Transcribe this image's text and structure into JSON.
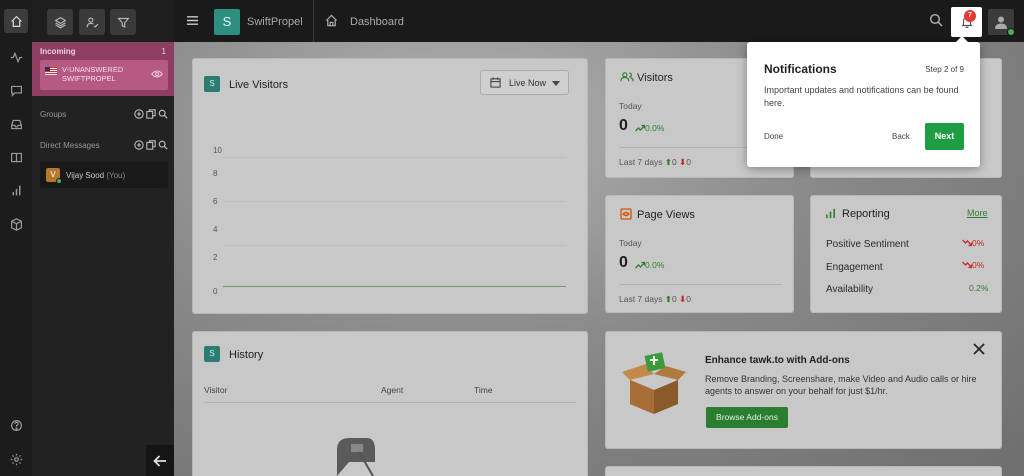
{
  "header": {
    "brand_initial": "S",
    "brand": "SwiftPropel",
    "breadcrumb": "Dashboard",
    "notification_count": "7"
  },
  "sidebar": {
    "incoming": {
      "title": "Incoming",
      "count": "1",
      "item_label": "V-UNANSWERED SWIFTPROPEL"
    },
    "groups_label": "Groups",
    "direct_messages_label": "Direct Messages",
    "dm_user": {
      "initial": "V",
      "name": "Vijay Sood",
      "suffix": "(You)"
    }
  },
  "live_visitors": {
    "badge": "S",
    "title": "Live Visitors",
    "dropdown_value": "Live Now",
    "y_ticks": [
      "10",
      "8",
      "6",
      "4",
      "2",
      "0"
    ]
  },
  "visitors": {
    "title": "Visitors",
    "today_label": "Today",
    "value": "0",
    "change": "0.0%",
    "last7_label": "Last 7 days",
    "up": "0",
    "down": "0"
  },
  "page_views": {
    "title": "Page Views",
    "today_label": "Today",
    "value": "0",
    "change": "0.0%",
    "last7_label": "Last 7 days",
    "up": "0",
    "down": "0"
  },
  "reporting": {
    "title": "Reporting",
    "more_label": "More",
    "rows": [
      {
        "label": "Positive Sentiment",
        "value": "0%"
      },
      {
        "label": "Engagement",
        "value": "0%"
      },
      {
        "label": "Availability",
        "value": "0.2%"
      }
    ]
  },
  "history": {
    "badge": "S",
    "title": "History",
    "columns": [
      "Visitor",
      "Agent",
      "Time"
    ]
  },
  "addons": {
    "title": "Enhance tawk.to with Add-ons",
    "description": "Remove Branding, Screenshare, make Video and Audio calls or hire agents to answer on your behalf for just $1/hr.",
    "button": "Browse Add-ons"
  },
  "tour": {
    "title": "Notifications",
    "step": "Step 2 of 9",
    "body": "Important updates and notifications can be found here.",
    "done": "Done",
    "back": "Back",
    "next": "Next"
  },
  "colors": {
    "brand_teal": "#2c8f80",
    "incoming_bg": "#8e3d63",
    "positive": "#2e7d32",
    "negative": "#c62828",
    "next_button": "#1e9e44"
  }
}
